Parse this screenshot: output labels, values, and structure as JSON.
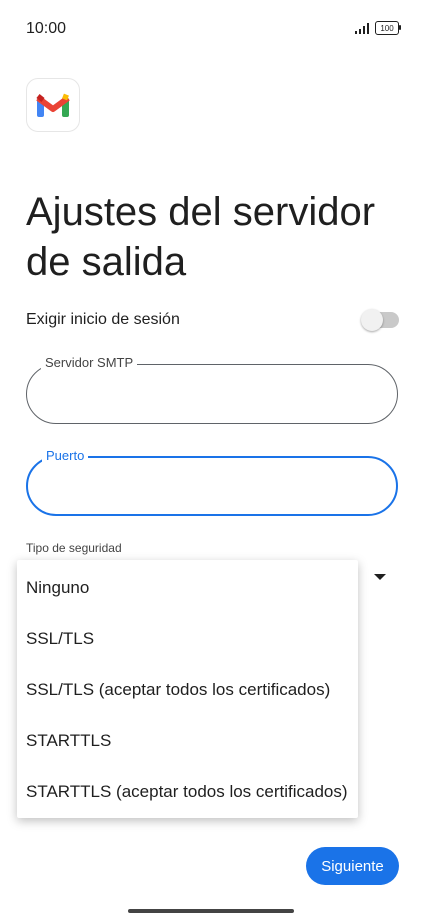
{
  "status_bar": {
    "time": "10:00",
    "battery": "100"
  },
  "header": {
    "title": "Ajustes del servidor de salida"
  },
  "login_toggle": {
    "label": "Exigir inicio de sesión",
    "on": false
  },
  "smtp_field": {
    "label": "Servidor SMTP",
    "value": ""
  },
  "port_field": {
    "label": "Puerto",
    "value": ""
  },
  "security": {
    "label": "Tipo de seguridad",
    "options": [
      "Ninguno",
      "SSL/TLS",
      "SSL/TLS (aceptar todos los certificados)",
      "STARTTLS",
      "STARTTLS (aceptar todos los certificados)"
    ]
  },
  "footer": {
    "next_label": "Siguiente"
  },
  "colors": {
    "accent": "#1a73e8"
  },
  "icons": {
    "app_logo": "gmail-logo-icon",
    "signal": "signal-icon",
    "battery": "battery-icon",
    "dropdown": "dropdown-arrow-icon"
  }
}
